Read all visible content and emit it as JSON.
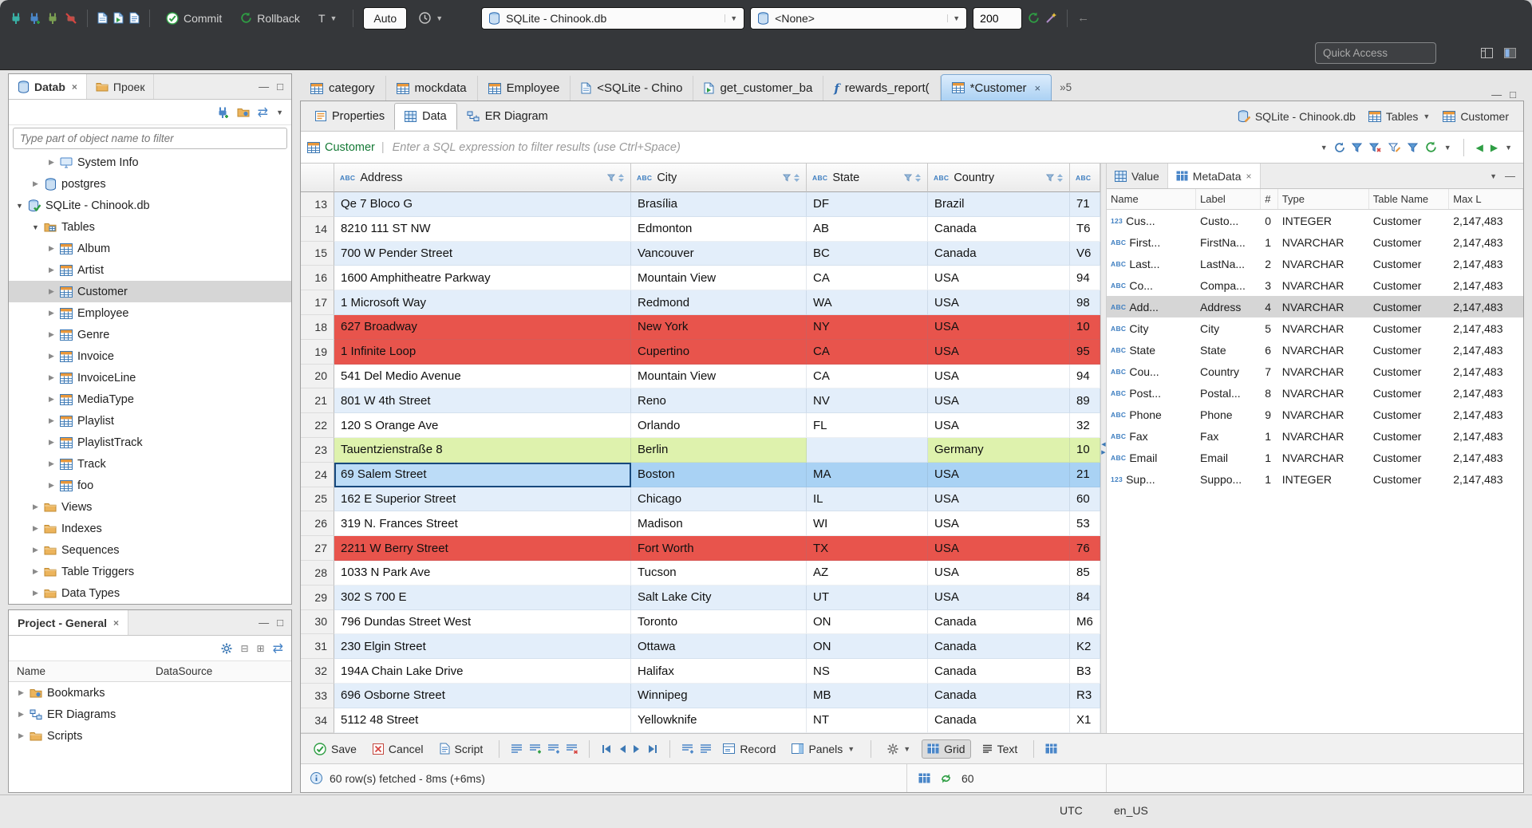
{
  "colors": {
    "accent_blue": "#3f7fc1",
    "row_alt": "#e3eefa",
    "row_error": "#e8544c",
    "row_new": "#def2ad",
    "row_selected": "#a9d2f4",
    "tab_active": "#abd1f3"
  },
  "topbar": {
    "commit_label": "Commit",
    "rollback_label": "Rollback",
    "tx_mode_label": "T",
    "auto_label": "Auto",
    "database_value": "SQLite - Chinook.db",
    "schema_value": "<None>",
    "fetch_size_value": "200",
    "quick_access_placeholder": "Quick Access"
  },
  "navigator": {
    "tab_database": "Datab",
    "tab_projects": "Проек",
    "filter_placeholder": "Type part of object name to filter",
    "tree": [
      {
        "label": "System Info",
        "icon": "sysinfo",
        "depth": 2,
        "arrow": "collapsed"
      },
      {
        "label": "postgres",
        "icon": "db",
        "depth": 1,
        "arrow": "collapsed"
      },
      {
        "label": "SQLite - Chinook.db",
        "icon": "dbcheck",
        "depth": 0,
        "arrow": "expanded"
      },
      {
        "label": "Tables",
        "icon": "foldertable",
        "depth": 1,
        "arrow": "expanded"
      },
      {
        "label": "Album",
        "icon": "table",
        "depth": 2,
        "arrow": "collapsed"
      },
      {
        "label": "Artist",
        "icon": "table",
        "depth": 2,
        "arrow": "collapsed"
      },
      {
        "label": "Customer",
        "icon": "table",
        "depth": 2,
        "arrow": "collapsed",
        "selected": true
      },
      {
        "label": "Employee",
        "icon": "table",
        "depth": 2,
        "arrow": "collapsed"
      },
      {
        "label": "Genre",
        "icon": "table",
        "depth": 2,
        "arrow": "collapsed"
      },
      {
        "label": "Invoice",
        "icon": "table",
        "depth": 2,
        "arrow": "collapsed"
      },
      {
        "label": "InvoiceLine",
        "icon": "table",
        "depth": 2,
        "arrow": "collapsed"
      },
      {
        "label": "MediaType",
        "icon": "table",
        "depth": 2,
        "arrow": "collapsed"
      },
      {
        "label": "Playlist",
        "icon": "table",
        "depth": 2,
        "arrow": "collapsed"
      },
      {
        "label": "PlaylistTrack",
        "icon": "table",
        "depth": 2,
        "arrow": "collapsed"
      },
      {
        "label": "Track",
        "icon": "table",
        "depth": 2,
        "arrow": "collapsed"
      },
      {
        "label": "foo",
        "icon": "table",
        "depth": 2,
        "arrow": "collapsed"
      },
      {
        "label": "Views",
        "icon": "folder",
        "depth": 1,
        "arrow": "collapsed"
      },
      {
        "label": "Indexes",
        "icon": "folder",
        "depth": 1,
        "arrow": "collapsed"
      },
      {
        "label": "Sequences",
        "icon": "folder",
        "depth": 1,
        "arrow": "collapsed"
      },
      {
        "label": "Table Triggers",
        "icon": "folder",
        "depth": 1,
        "arrow": "collapsed"
      },
      {
        "label": "Data Types",
        "icon": "folder",
        "depth": 1,
        "arrow": "collapsed"
      }
    ]
  },
  "project_panel": {
    "title": "Project - General",
    "col_name": "Name",
    "col_datasource": "DataSource",
    "items": [
      {
        "label": "Bookmarks",
        "icon": "folderstar"
      },
      {
        "label": "ER Diagrams",
        "icon": "er"
      },
      {
        "label": "Scripts",
        "icon": "folder"
      }
    ]
  },
  "editor_tabs": {
    "tabs": [
      {
        "label": "category",
        "icon": "table"
      },
      {
        "label": "mockdata",
        "icon": "table"
      },
      {
        "label": "Employee",
        "icon": "table"
      },
      {
        "label": "<SQLite - Chino",
        "icon": "sql"
      },
      {
        "label": "get_customer_ba",
        "icon": "sqlexec"
      },
      {
        "label": "rewards_report(",
        "icon": "fn"
      },
      {
        "label": "*Customer",
        "icon": "table",
        "active": true
      }
    ],
    "overflow_label": "»5"
  },
  "editor": {
    "subtabs": [
      {
        "label": "Properties",
        "icon": "props"
      },
      {
        "label": "Data",
        "icon": "grid",
        "active": true
      },
      {
        "label": "ER Diagram",
        "icon": "er"
      }
    ],
    "context_db": "SQLite - Chinook.db",
    "context_container": "Tables",
    "context_table": "Customer"
  },
  "filter_bar": {
    "table_label": "Customer",
    "placeholder": "Enter a SQL expression to filter results (use Ctrl+Space)"
  },
  "grid": {
    "columns": [
      {
        "label": "Address",
        "type": "ABC"
      },
      {
        "label": "City",
        "type": "ABC"
      },
      {
        "label": "State",
        "type": "ABC"
      },
      {
        "label": "Country",
        "type": "ABC"
      },
      {
        "label": "",
        "type": "ABC"
      }
    ],
    "rows": [
      {
        "num": "13",
        "cells": [
          "Qe 7 Bloco G",
          "Brasília",
          "DF",
          "Brazil",
          "71"
        ],
        "hl": "alt"
      },
      {
        "num": "14",
        "cells": [
          "8210 111 ST NW",
          "Edmonton",
          "AB",
          "Canada",
          "T6"
        ],
        "hl": ""
      },
      {
        "num": "15",
        "cells": [
          "700 W Pender Street",
          "Vancouver",
          "BC",
          "Canada",
          "V6"
        ],
        "hl": "alt"
      },
      {
        "num": "16",
        "cells": [
          "1600 Amphitheatre Parkway",
          "Mountain View",
          "CA",
          "USA",
          "94"
        ],
        "hl": ""
      },
      {
        "num": "17",
        "cells": [
          "1 Microsoft Way",
          "Redmond",
          "WA",
          "USA",
          "98"
        ],
        "hl": "alt"
      },
      {
        "num": "18",
        "cells": [
          "627 Broadway",
          "New York",
          "NY",
          "USA",
          "10"
        ],
        "hl": "error"
      },
      {
        "num": "19",
        "cells": [
          "1 Infinite Loop",
          "Cupertino",
          "CA",
          "USA",
          "95"
        ],
        "hl": "error"
      },
      {
        "num": "20",
        "cells": [
          "541 Del Medio Avenue",
          "Mountain View",
          "CA",
          "USA",
          "94"
        ],
        "hl": ""
      },
      {
        "num": "21",
        "cells": [
          "801 W 4th Street",
          "Reno",
          "NV",
          "USA",
          "89"
        ],
        "hl": "alt"
      },
      {
        "num": "22",
        "cells": [
          "120 S Orange Ave",
          "Orlando",
          "FL",
          "USA",
          "32"
        ],
        "hl": ""
      },
      {
        "num": "23",
        "cells": [
          "Tauentzienstraße 8",
          "Berlin",
          "",
          "Germany",
          "10"
        ],
        "hl": "new"
      },
      {
        "num": "24",
        "cells": [
          "69 Salem Street",
          "Boston",
          "MA",
          "USA",
          "21"
        ],
        "hl": "selected",
        "focus_cell": 0
      },
      {
        "num": "25",
        "cells": [
          "162 E Superior Street",
          "Chicago",
          "IL",
          "USA",
          "60"
        ],
        "hl": "alt"
      },
      {
        "num": "26",
        "cells": [
          "319 N. Frances Street",
          "Madison",
          "WI",
          "USA",
          "53"
        ],
        "hl": ""
      },
      {
        "num": "27",
        "cells": [
          "2211 W Berry Street",
          "Fort Worth",
          "TX",
          "USA",
          "76"
        ],
        "hl": "error"
      },
      {
        "num": "28",
        "cells": [
          "1033 N Park Ave",
          "Tucson",
          "AZ",
          "USA",
          "85"
        ],
        "hl": ""
      },
      {
        "num": "29",
        "cells": [
          "302 S 700 E",
          "Salt Lake City",
          "UT",
          "USA",
          "84"
        ],
        "hl": "alt"
      },
      {
        "num": "30",
        "cells": [
          "796 Dundas Street West",
          "Toronto",
          "ON",
          "Canada",
          "M6"
        ],
        "hl": ""
      },
      {
        "num": "31",
        "cells": [
          "230 Elgin Street",
          "Ottawa",
          "ON",
          "Canada",
          "K2"
        ],
        "hl": "alt"
      },
      {
        "num": "32",
        "cells": [
          "194A Chain Lake Drive",
          "Halifax",
          "NS",
          "Canada",
          "B3"
        ],
        "hl": ""
      },
      {
        "num": "33",
        "cells": [
          "696 Osborne Street",
          "Winnipeg",
          "MB",
          "Canada",
          "R3"
        ],
        "hl": "alt"
      },
      {
        "num": "34",
        "cells": [
          "5112 48 Street",
          "Yellowknife",
          "NT",
          "Canada",
          "X1"
        ],
        "hl": ""
      }
    ]
  },
  "metadata_panel": {
    "tab_value": "Value",
    "tab_metadata": "MetaData",
    "columns": [
      "Name",
      "Label",
      "#",
      "Type",
      "Table Name",
      "Max L"
    ],
    "rows": [
      {
        "icon": "123",
        "name": "Cus...",
        "label": "Custo...",
        "num": "0",
        "type": "INTEGER",
        "table": "Customer",
        "max": "2,147,483"
      },
      {
        "icon": "ABC",
        "name": "First...",
        "label": "FirstNa...",
        "num": "1",
        "type": "NVARCHAR",
        "table": "Customer",
        "max": "2,147,483"
      },
      {
        "icon": "ABC",
        "name": "Last...",
        "label": "LastNa...",
        "num": "2",
        "type": "NVARCHAR",
        "table": "Customer",
        "max": "2,147,483"
      },
      {
        "icon": "ABC",
        "name": "Co...",
        "label": "Compa...",
        "num": "3",
        "type": "NVARCHAR",
        "table": "Customer",
        "max": "2,147,483"
      },
      {
        "icon": "ABC",
        "name": "Add...",
        "label": "Address",
        "num": "4",
        "type": "NVARCHAR",
        "table": "Customer",
        "max": "2,147,483",
        "selected": true
      },
      {
        "icon": "ABC",
        "name": "City",
        "label": "City",
        "num": "5",
        "type": "NVARCHAR",
        "table": "Customer",
        "max": "2,147,483"
      },
      {
        "icon": "ABC",
        "name": "State",
        "label": "State",
        "num": "6",
        "type": "NVARCHAR",
        "table": "Customer",
        "max": "2,147,483"
      },
      {
        "icon": "ABC",
        "name": "Cou...",
        "label": "Country",
        "num": "7",
        "type": "NVARCHAR",
        "table": "Customer",
        "max": "2,147,483"
      },
      {
        "icon": "ABC",
        "name": "Post...",
        "label": "Postal...",
        "num": "8",
        "type": "NVARCHAR",
        "table": "Customer",
        "max": "2,147,483"
      },
      {
        "icon": "ABC",
        "name": "Phone",
        "label": "Phone",
        "num": "9",
        "type": "NVARCHAR",
        "table": "Customer",
        "max": "2,147,483"
      },
      {
        "icon": "ABC",
        "name": "Fax",
        "label": "Fax",
        "num": "1",
        "type": "NVARCHAR",
        "table": "Customer",
        "max": "2,147,483"
      },
      {
        "icon": "ABC",
        "name": "Email",
        "label": "Email",
        "num": "1",
        "type": "NVARCHAR",
        "table": "Customer",
        "max": "2,147,483"
      },
      {
        "icon": "123",
        "name": "Sup...",
        "label": "Suppo...",
        "num": "1",
        "type": "INTEGER",
        "table": "Customer",
        "max": "2,147,483"
      }
    ]
  },
  "bottom_toolbar": {
    "save_label": "Save",
    "cancel_label": "Cancel",
    "script_label": "Script",
    "record_label": "Record",
    "panels_label": "Panels",
    "grid_label": "Grid",
    "text_label": "Text"
  },
  "status_row": {
    "message": "60 row(s) fetched - 8ms (+6ms)",
    "refresh_count": "60"
  },
  "window_status": {
    "timezone": "UTC",
    "locale": "en_US"
  }
}
